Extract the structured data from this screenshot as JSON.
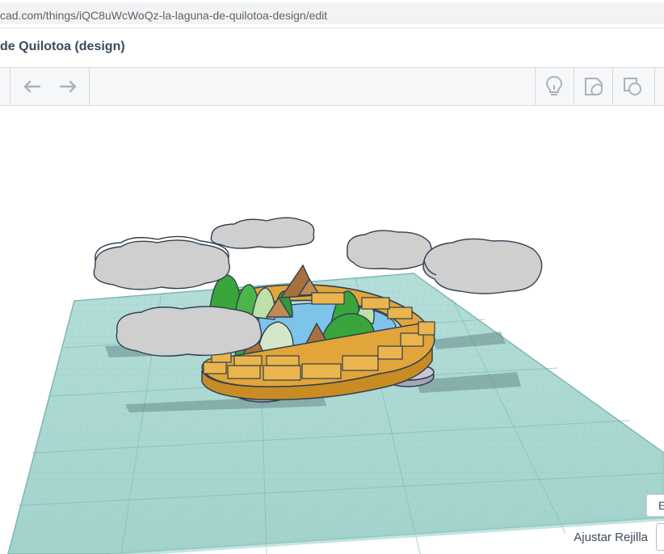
{
  "browser": {
    "url_visible": "cad.com/things/iQC8uWcWoQz-la-laguna-de-quilotoa-design/edit"
  },
  "design": {
    "title": "de Quilotoa (design)"
  },
  "toolbar": {
    "undo_icon": "undo-arrow-icon",
    "redo_icon": "redo-arrow-icon",
    "hint_icon": "lightbulb-icon",
    "notes_icon": "note-shape-icon",
    "ruler_icon": "shape-outline-icon"
  },
  "workplane": {
    "edit_grid_label": "E",
    "snap_grid_label": "Ajustar Rejilla"
  },
  "colors": {
    "grid": "#a9d8d2",
    "grid_line": "#8ec6c0",
    "wall": "#e2a53a",
    "lake": "#7ec3ea",
    "tree_green": "#3aa53a",
    "mountain": "#a7703f",
    "cloud": "#cfcfcf",
    "outline": "#2f4050"
  }
}
